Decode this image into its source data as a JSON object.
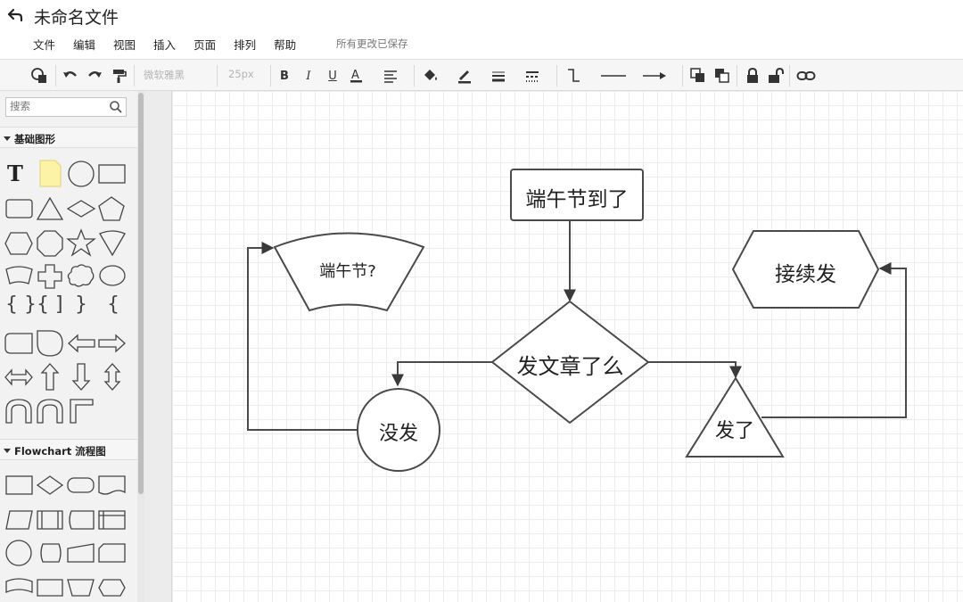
{
  "header": {
    "title": "未命名文件",
    "save_status": "所有更改已保存"
  },
  "menu": [
    "文件",
    "编辑",
    "视图",
    "插入",
    "页面",
    "排列",
    "帮助"
  ],
  "toolbar": {
    "font_family": "微软雅黑",
    "font_size": "25px",
    "icons": [
      "shapes-icon",
      "undo-icon",
      "redo-icon",
      "format-painter-icon",
      "bold-icon",
      "italic-icon",
      "underline-icon",
      "font-color-icon",
      "align-icon",
      "fill-color-icon",
      "line-color-icon",
      "line-width-icon",
      "line-style-icon",
      "connector-style-icon",
      "line-type-icon",
      "arrow-icon",
      "bring-front-icon",
      "send-back-icon",
      "lock-icon",
      "unlock-icon",
      "link-icon"
    ]
  },
  "sidebar": {
    "search_placeholder": "搜索",
    "sections": [
      {
        "title": "基础图形"
      },
      {
        "title": "Flowchart 流程图"
      }
    ]
  },
  "diagram": {
    "nodes": {
      "start": "端午节到了",
      "decision": "发文章了么",
      "manual": "端午节?",
      "no": "没发",
      "yes": "发了",
      "continue": "接续发"
    }
  },
  "colors": {
    "stroke": "#4a4a4a",
    "toolbar_bg": "#f6f6f6",
    "sidebar_bg": "#f2f2f2",
    "note_yellow": "#fdf3a6"
  }
}
